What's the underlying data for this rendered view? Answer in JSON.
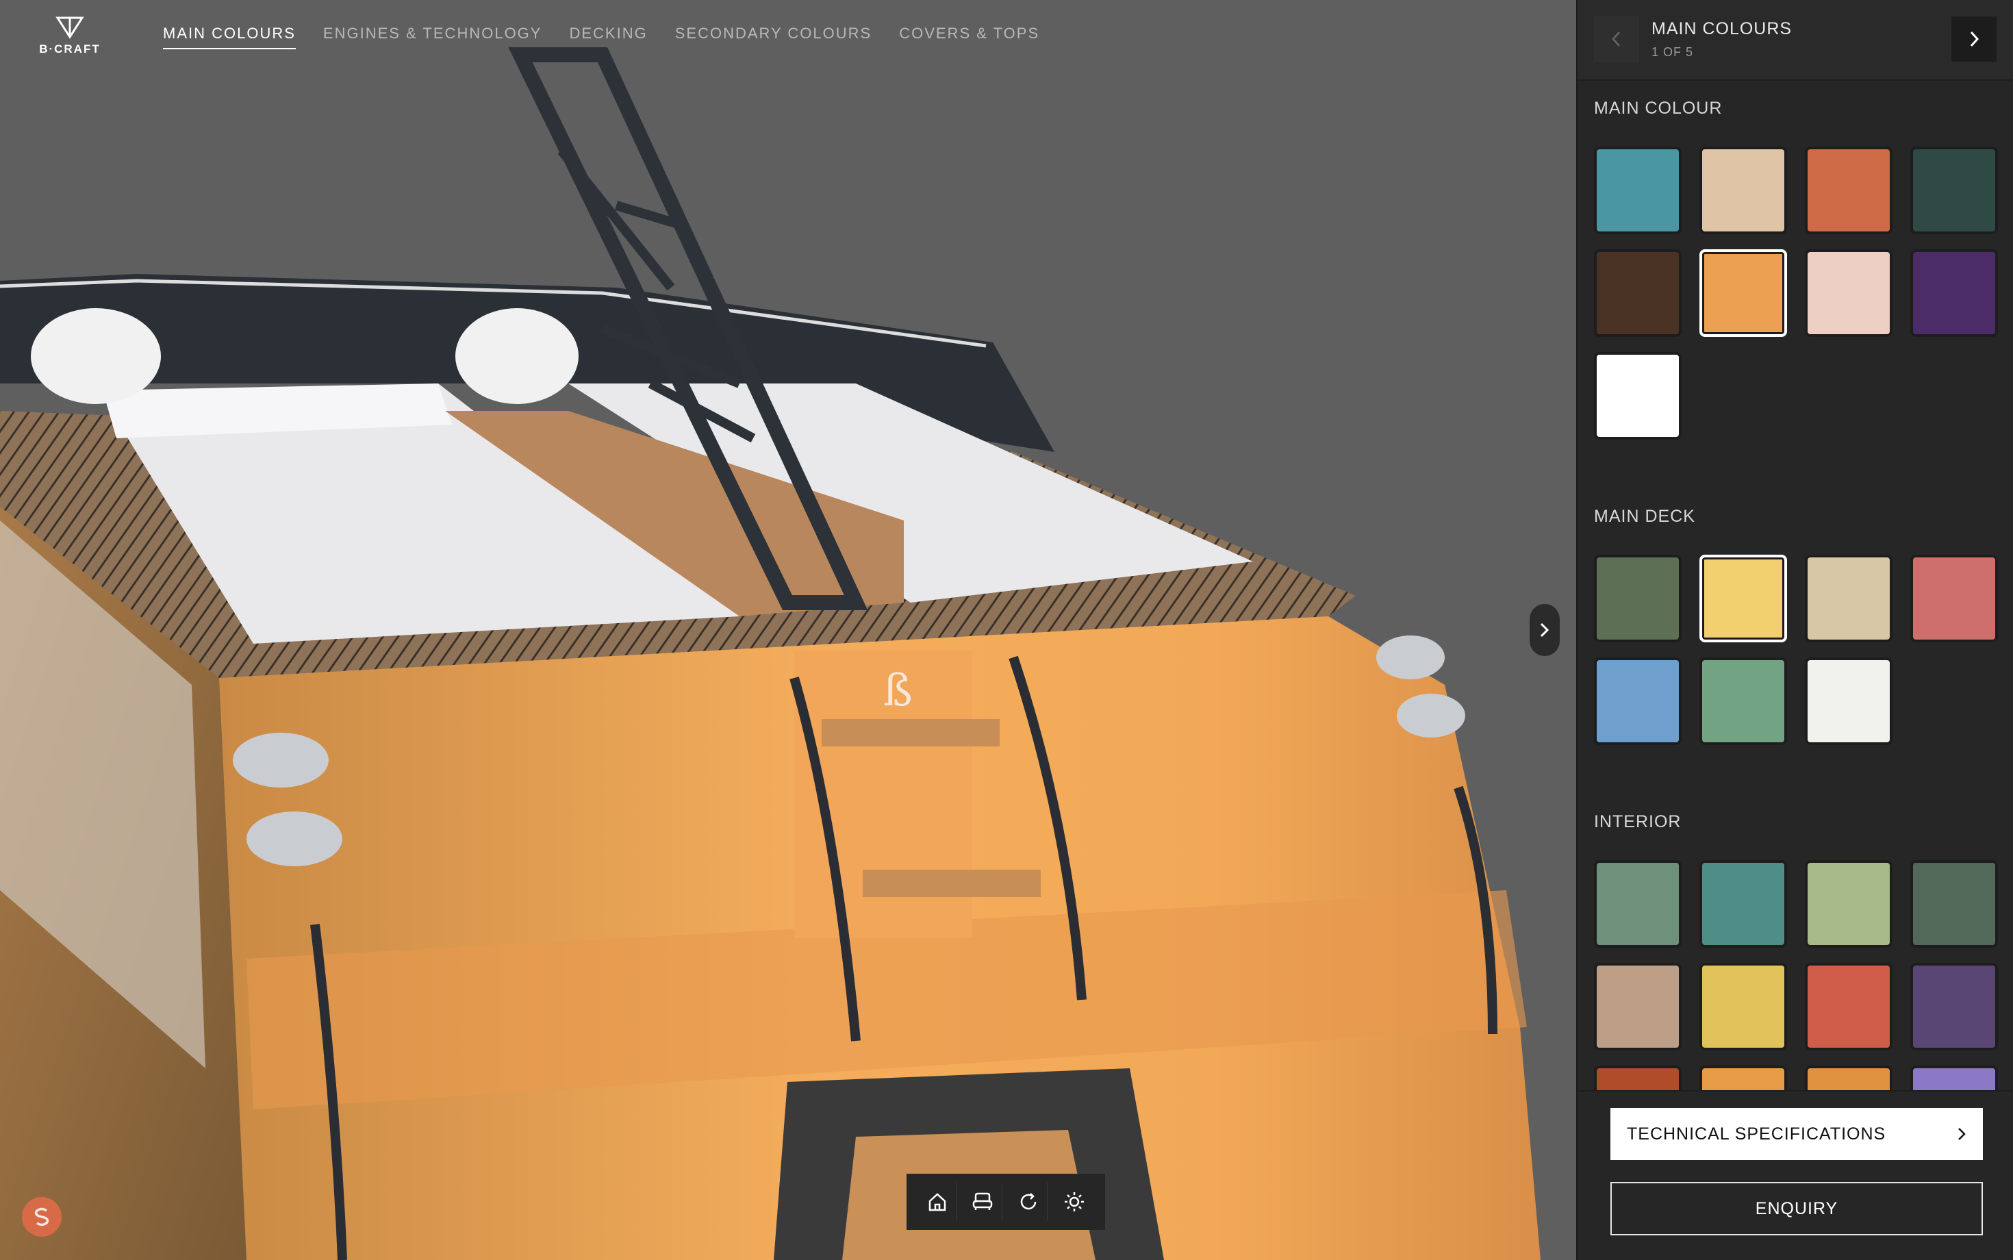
{
  "brand": {
    "logo_text": "B·CRAFT"
  },
  "nav": {
    "items": [
      {
        "label": "MAIN COLOURS",
        "active": true
      },
      {
        "label": "ENGINES & TECHNOLOGY",
        "active": false
      },
      {
        "label": "DECKING",
        "active": false
      },
      {
        "label": "SECONDARY COLOURS",
        "active": false
      },
      {
        "label": "COVERS & TOPS",
        "active": false
      }
    ]
  },
  "panel": {
    "step_title": "MAIN COLOURS",
    "step_count": "1 OF 5",
    "sections": [
      {
        "title": "MAIN COLOUR",
        "swatches": [
          "#4a96a3",
          "#dfc4a6",
          "#cf6a47",
          "#2f4a45",
          "#4a3225",
          "#eba052",
          "#edcfc4",
          "#4b2c68",
          "#ffffff"
        ],
        "selected": 5
      },
      {
        "title": "MAIN DECK",
        "swatches": [
          "#5d6f55",
          "#f2cf6f",
          "#d7c7a6",
          "#cf6f6b",
          "#6f9fcc",
          "#72a383",
          "#f1f1ee"
        ],
        "selected": 1
      },
      {
        "title": "INTERIOR",
        "swatches": [
          "#6f907b",
          "#4f8e86",
          "#a8ba8a",
          "#52695a",
          "#bd9f87",
          "#e2c25a",
          "#cf5d49",
          "#5a4675",
          "#b14c2a",
          "#e89b47",
          "#e09241",
          "#8b79c7"
        ],
        "selected": -1
      }
    ]
  },
  "footer": {
    "tech_label": "TECHNICAL SPECIFICATIONS",
    "enquiry_label": "ENQUIRY"
  },
  "toolbar": {
    "buttons": [
      {
        "icon": "home-icon"
      },
      {
        "icon": "seat-icon"
      },
      {
        "icon": "refresh-icon"
      },
      {
        "icon": "sun-icon"
      }
    ]
  },
  "colors": {
    "hull": "#f0a553",
    "panel_bg": "#262626",
    "viewport_bg": "#5f5f5f"
  }
}
